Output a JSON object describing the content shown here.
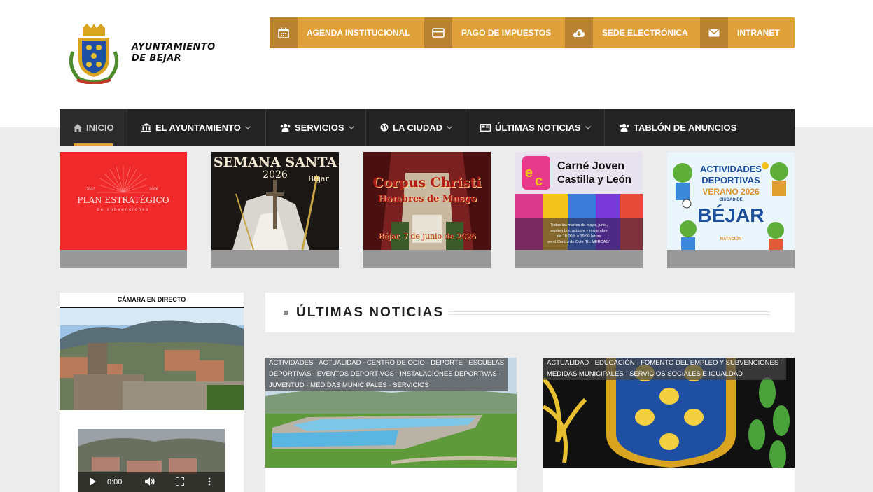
{
  "brand": {
    "line1": "AYUNTAMIENTO",
    "line2": "DE BEJAR"
  },
  "colors": {
    "accent": "#e1a13a",
    "accent_dark": "#b98232",
    "nav_bg": "#242424",
    "page_bg": "#ececec"
  },
  "topnav": [
    {
      "label": "AGENDA INSTITUCIONAL",
      "icon": "calendar-icon"
    },
    {
      "label": "PAGO DE IMPUESTOS",
      "icon": "credit-card-icon"
    },
    {
      "label": "SEDE ELECTRÓNICA",
      "icon": "cloud-download-icon"
    },
    {
      "label": "INTRANET",
      "icon": "envelope-icon"
    }
  ],
  "mainnav": [
    {
      "label": "INICIO",
      "icon": "home-icon",
      "dropdown": false,
      "active": true
    },
    {
      "label": "EL AYUNTAMIENTO",
      "icon": "institution-icon",
      "dropdown": true
    },
    {
      "label": "SERVICIOS",
      "icon": "users-icon",
      "dropdown": true
    },
    {
      "label": "LA CIUDAD",
      "icon": "globe-icon",
      "dropdown": true
    },
    {
      "label": "ÚLTIMAS NOTICIAS",
      "icon": "newspaper-icon",
      "dropdown": true
    },
    {
      "label": "TABLÓN DE ANUNCIOS",
      "icon": "users-icon",
      "dropdown": false
    }
  ],
  "banners": {
    "plan": {
      "years_left": "2023",
      "years_right": "2026",
      "title": "PLAN ESTRATÉGICO",
      "subtitle": "de subvenciones"
    },
    "semana": {
      "title": "SEMANA SANTA",
      "year": "2026",
      "place": "Béjar"
    },
    "corpus": {
      "title": "Corpus Christi",
      "subtitle": "Hombres de Musgo",
      "date": "Béjar, 7 de junio de 2026"
    },
    "carne": {
      "title1": "Carné Joven",
      "title2": "Castilla y León",
      "info1": "Todos los martes de mayo, junio,",
      "info2": "septiembre, octubre y noviembre",
      "info3": "de 18:00 h a 19:00 horas",
      "info4": "en el Centro de Ocio \"EL MERCAO\""
    },
    "deportes": {
      "l1": "ACTIVIDADES",
      "l2": "DEPORTIVAS",
      "l3": "VERANO 2026",
      "l4": "CIUDAD DE",
      "l5": "BÉJAR",
      "l6": "NATACIÓN"
    }
  },
  "camera": {
    "title": "CÁMARA EN DIRECTO",
    "time": "0:00"
  },
  "news": {
    "heading": "ÚLTIMAS NOTICIAS",
    "cards": [
      {
        "categories": [
          "ACTIVIDADES · ACTUALIDAD · CENTRO DE OCIO · DEPORTE · ESCUELAS",
          "DEPORTIVAS · EVENTOS DEPORTIVOS · INSTALACIONES DEPORTIVAS ·",
          "JUVENTUD · MEDIDAS MUNICIPALES · SERVICIOS"
        ]
      },
      {
        "categories": [
          "ACTUALIDAD · EDUCACIÓN · FOMENTO DEL EMPLEO Y SUBVENCIONES ·",
          "MEDIDAS MUNICIPALES · SERVICIOS SOCIALES E IGUALDAD"
        ]
      }
    ]
  }
}
